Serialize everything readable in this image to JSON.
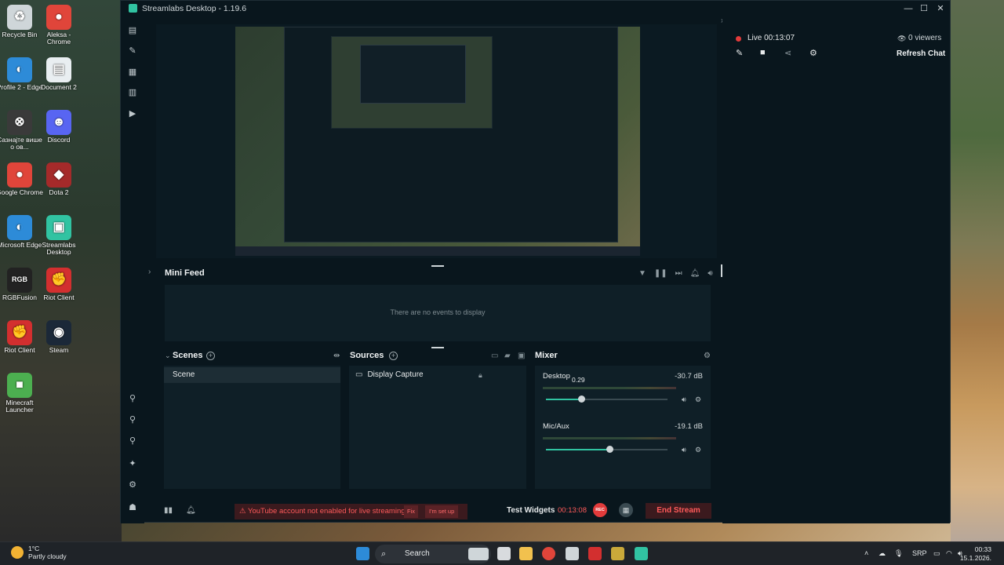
{
  "window": {
    "title": "Streamlabs Desktop - 1.19.6",
    "min": "—",
    "max": "☐",
    "close": "✕"
  },
  "desktop_icons": [
    {
      "label": "Recycle Bin",
      "glyph": "♻",
      "color": "#cfd6d9"
    },
    {
      "label": "Aleksa - Chrome",
      "glyph": "●",
      "color": "#e0453a"
    },
    {
      "label": "Profile 2 - Edge",
      "glyph": "◐",
      "color": "#2d8bd8"
    },
    {
      "label": "Document 2",
      "glyph": "▤",
      "color": "#e9eef1"
    },
    {
      "label": "Сазнајте више о ов...",
      "glyph": "⊗",
      "color": "#3a3a3a"
    },
    {
      "label": "Discord",
      "glyph": "☻",
      "color": "#5865f2"
    },
    {
      "label": "Google Chrome",
      "glyph": "●",
      "color": "#e0453a"
    },
    {
      "label": "Dota 2",
      "glyph": "◆",
      "color": "#a52a2a"
    },
    {
      "label": "Microsoft Edge",
      "glyph": "◐",
      "color": "#2d8bd8"
    },
    {
      "label": "Streamlabs Desktop",
      "glyph": "▣",
      "color": "#31c3a2"
    },
    {
      "label": "RGBFusion",
      "glyph": "RGB",
      "color": "#222"
    },
    {
      "label": "Riot Client",
      "glyph": "✊",
      "color": "#d32f2f"
    },
    {
      "label": "Riot Client",
      "glyph": "✊",
      "color": "#d32f2f"
    },
    {
      "label": "Steam",
      "glyph": "◉",
      "color": "#1b2838"
    },
    {
      "label": "Minecraft Launcher",
      "glyph": "■",
      "color": "#4caf50"
    }
  ],
  "chat": {
    "live_text": "Live 00:13:07",
    "viewers": "0 viewers",
    "refresh": "Refresh Chat"
  },
  "minifeed": {
    "title": "Mini Feed",
    "empty": "There are no events to display"
  },
  "scenes": {
    "title": "Scenes",
    "items": [
      "Scene"
    ]
  },
  "sources": {
    "title": "Sources",
    "items": [
      "Display Capture"
    ]
  },
  "mixer": {
    "title": "Mixer",
    "channels": [
      {
        "name": "Desktop",
        "db": "-30.7 dB",
        "level": 0.29,
        "tooltip": "0.29"
      },
      {
        "name": "Mic/Aux",
        "db": "-19.1 dB",
        "level": 0.52
      }
    ]
  },
  "footer": {
    "warning": "YouTube account not enabled for live streaming",
    "fix": "Fix",
    "setup": "I'm set up",
    "test_widgets": "Test Widgets",
    "timer": "00:13:08",
    "rec": "REC",
    "end_stream": "End Stream"
  },
  "taskbar": {
    "weather_temp": "1°C",
    "weather_desc": "Partly cloudy",
    "search": "Search",
    "lang": "SRP",
    "time": "00:33",
    "date": "15.1.2026."
  },
  "colors": {
    "accent": "#31c3a2",
    "live_red": "#e23b3b",
    "window_bg": "#09161d",
    "panel_bg": "#0f1f27"
  }
}
